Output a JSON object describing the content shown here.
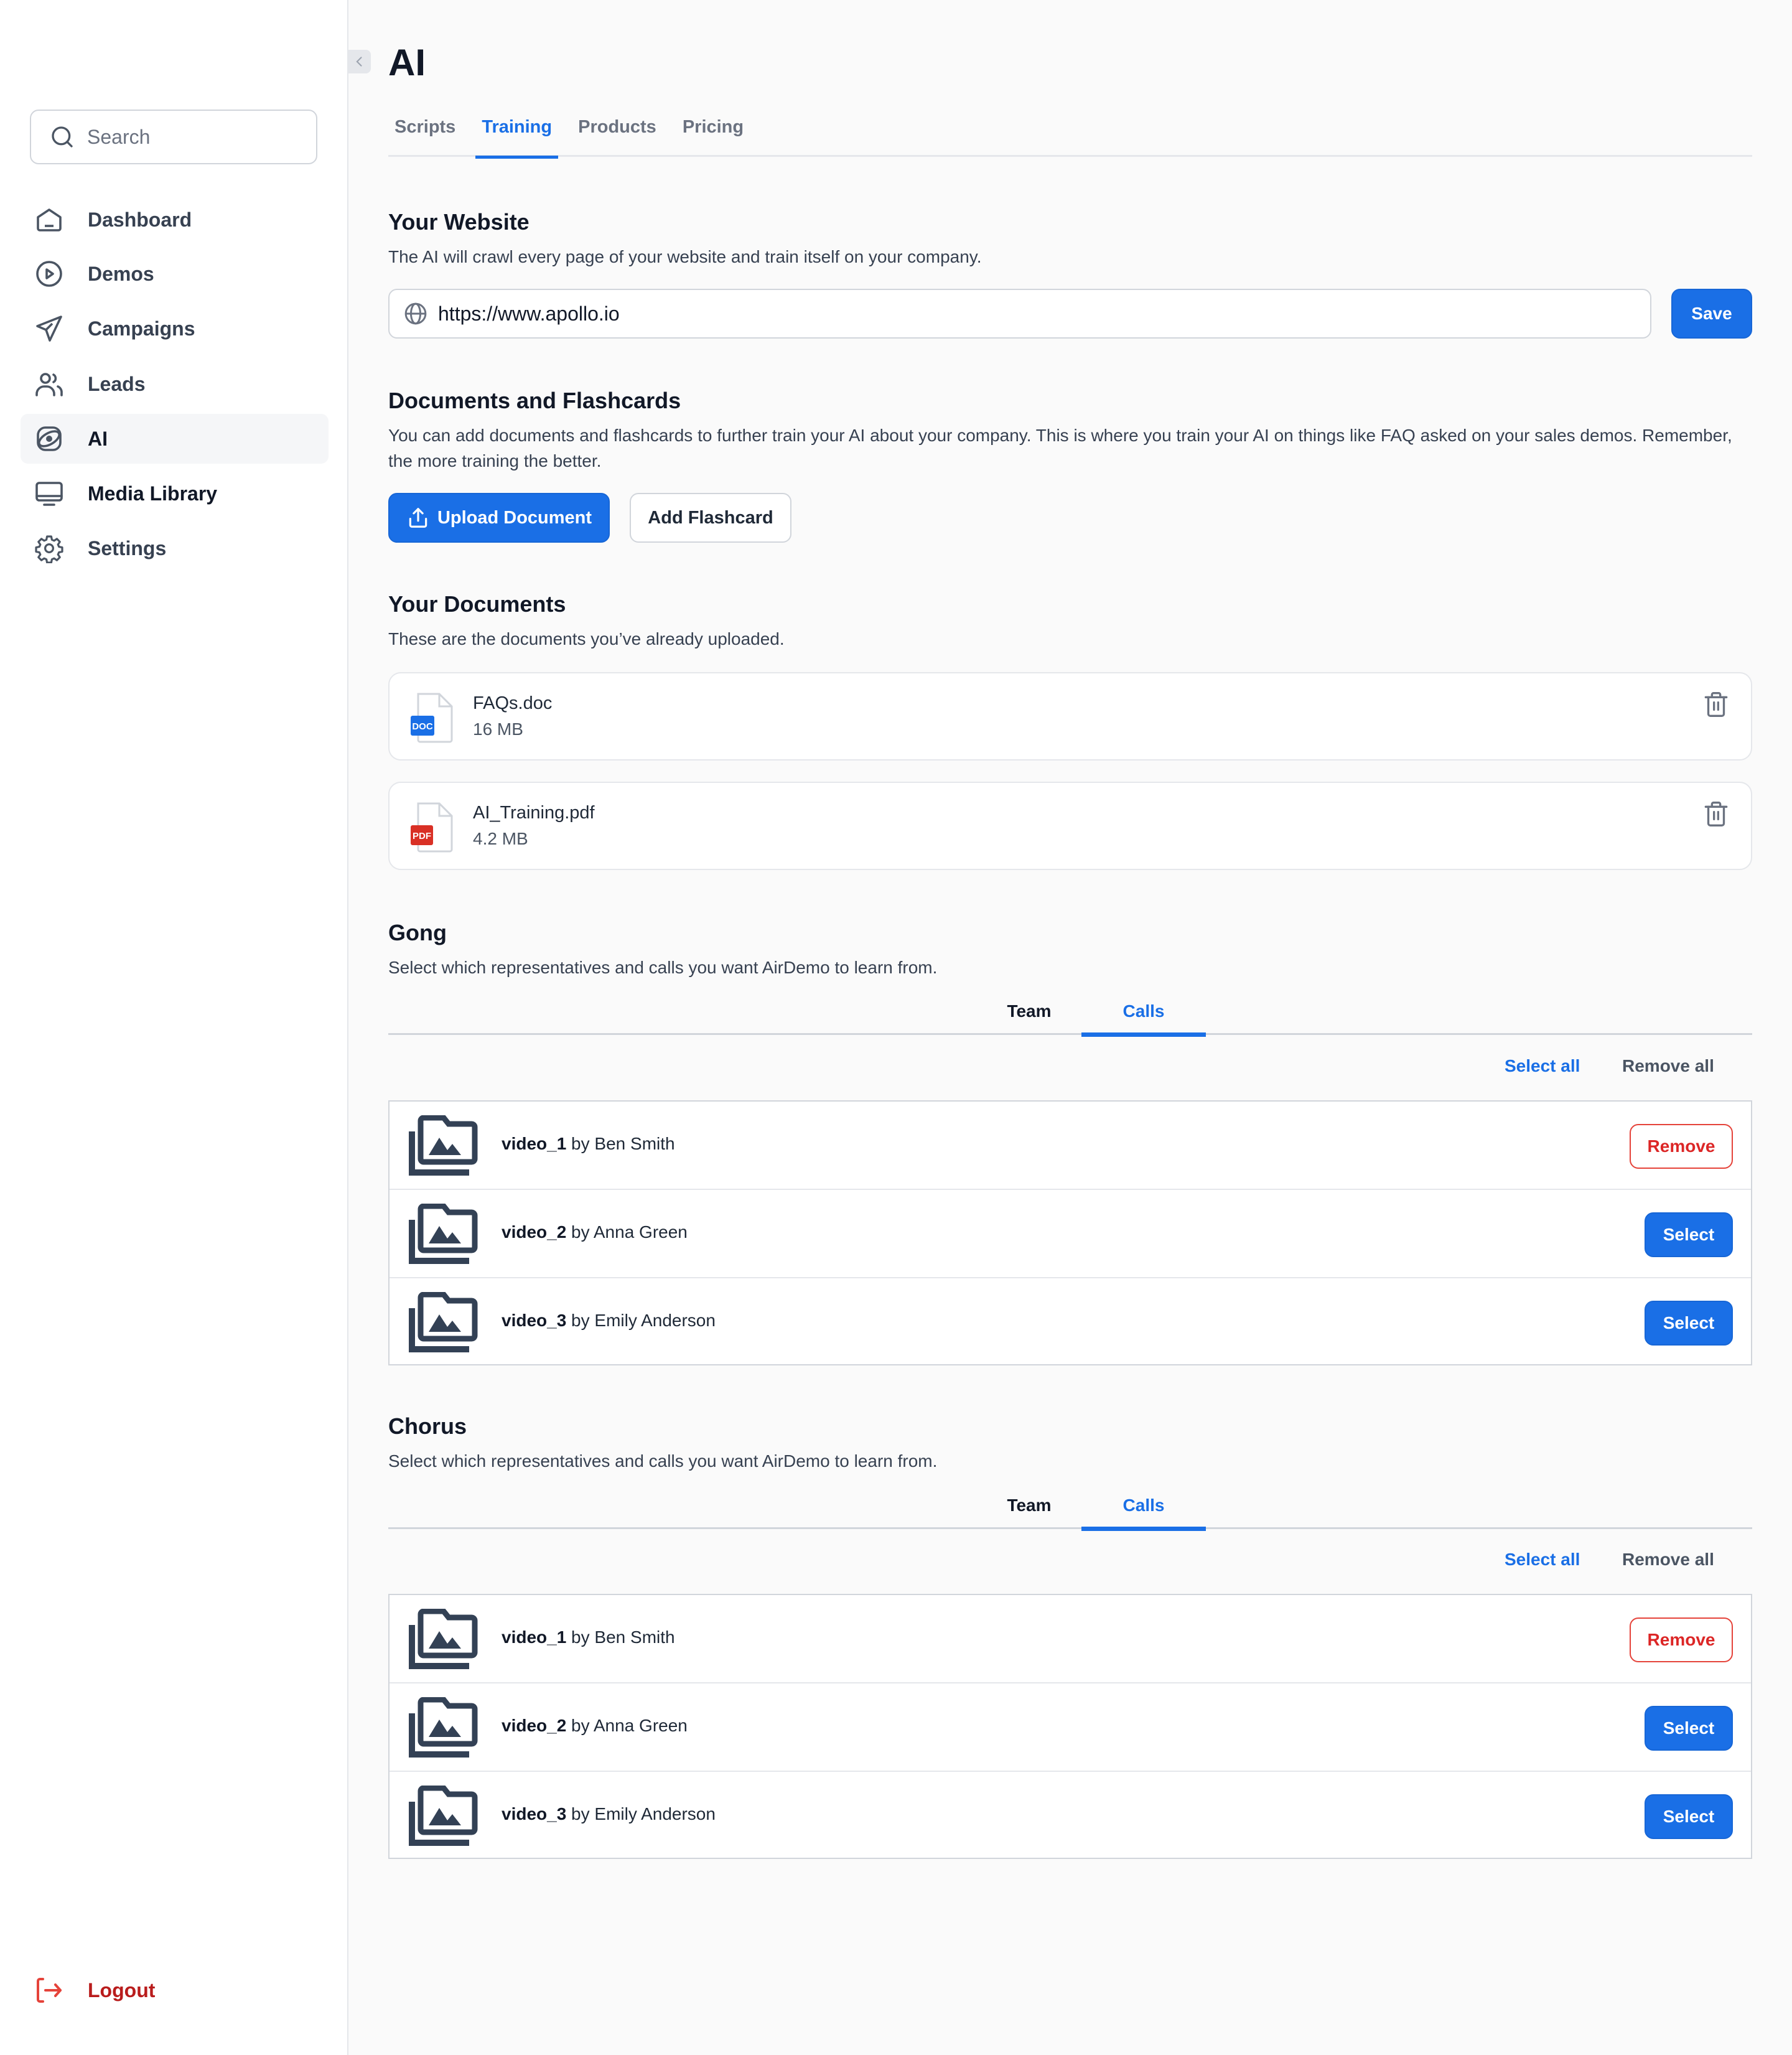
{
  "sidebar": {
    "search_placeholder": "Search",
    "items": [
      {
        "label": "Dashboard",
        "icon": "home-icon"
      },
      {
        "label": "Demos",
        "icon": "play-circle-icon"
      },
      {
        "label": "Campaigns",
        "icon": "send-icon"
      },
      {
        "label": "Leads",
        "icon": "users-icon"
      },
      {
        "label": "AI",
        "icon": "atom-icon",
        "active": true
      },
      {
        "label": "Media Library",
        "icon": "monitor-icon"
      },
      {
        "label": "Settings",
        "icon": "gear-icon"
      }
    ],
    "logout_label": "Logout"
  },
  "header": {
    "title": "AI",
    "tabs": [
      {
        "label": "Scripts"
      },
      {
        "label": "Training",
        "active": true
      },
      {
        "label": "Products"
      },
      {
        "label": "Pricing"
      }
    ]
  },
  "website": {
    "heading": "Your Website",
    "description": "The AI will crawl every page of your website and train itself on your company.",
    "url_value": "https://www.apollo.io",
    "save_label": "Save"
  },
  "docs_flashcards": {
    "heading": "Documents and Flashcards",
    "description": "You can add documents and flashcards to further train your AI about your company. This is where you train your AI on things like FAQ asked on your sales demos. Remember, the more training the better.",
    "upload_label": "Upload Document",
    "flashcard_label": "Add Flashcard"
  },
  "your_documents": {
    "heading": "Your Documents",
    "description": "These are the documents you’ve already uploaded.",
    "files": [
      {
        "name": "FAQs.doc",
        "size": "16 MB",
        "badge": "DOC",
        "badge_color": "#1a6fe6"
      },
      {
        "name": "AI_Training.pdf",
        "size": "4.2 MB",
        "badge": "PDF",
        "badge_color": "#d93025"
      }
    ]
  },
  "gong": {
    "heading": "Gong",
    "description": "Select which representatives and calls you want AirDemo to learn from.",
    "tabs": {
      "team": "Team",
      "calls": "Calls"
    },
    "select_all": "Select all",
    "remove_all": "Remove all",
    "calls": [
      {
        "video": "video_1",
        "by": " by Ben Smith",
        "action": "Remove"
      },
      {
        "video": "video_2",
        "by": " by Anna Green",
        "action": "Select"
      },
      {
        "video": "video_3",
        "by": " by Emily Anderson",
        "action": "Select"
      }
    ]
  },
  "chorus": {
    "heading": "Chorus",
    "description": "Select which representatives and calls you want AirDemo to learn from.",
    "tabs": {
      "team": "Team",
      "calls": "Calls"
    },
    "select_all": "Select all",
    "remove_all": "Remove all",
    "calls": [
      {
        "video": "video_1",
        "by": " by Ben Smith",
        "action": "Remove"
      },
      {
        "video": "video_2",
        "by": " by Anna Green",
        "action": "Select"
      },
      {
        "video": "video_3",
        "by": " by Emily Anderson",
        "action": "Select"
      }
    ]
  },
  "colors": {
    "accent": "#1a6fe6",
    "danger": "#dc2626",
    "logout": "#b91c1c"
  }
}
